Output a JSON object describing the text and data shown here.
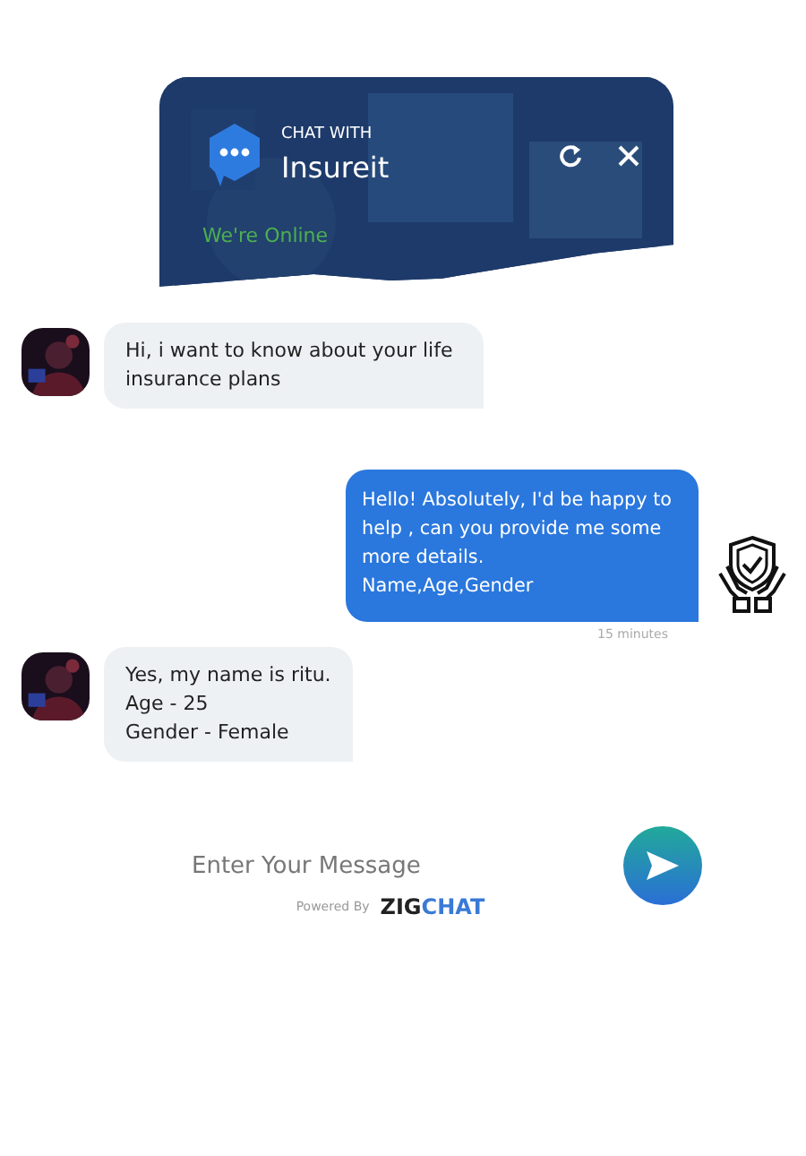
{
  "header": {
    "eyebrow": "CHAT WITH",
    "title": "Insureit",
    "status": "We're Online"
  },
  "messages": [
    {
      "kind": "incoming",
      "lines": [
        "Hi, i want to know about your life insurance plans"
      ]
    },
    {
      "kind": "outgoing",
      "lines": [
        "Hello! Absolutely, I'd be happy to help , can you provide me some more details.",
        "Name,Age,Gender"
      ],
      "time": "15 minutes"
    },
    {
      "kind": "incoming",
      "lines": [
        "Yes, my name is ritu.",
        "Age - 25",
        "Gender - Female"
      ]
    }
  ],
  "composer": {
    "placeholder": "Enter Your Message"
  },
  "footer": {
    "powered": "Powered By",
    "brand_1": "ZIG",
    "brand_2": "CHAT"
  }
}
